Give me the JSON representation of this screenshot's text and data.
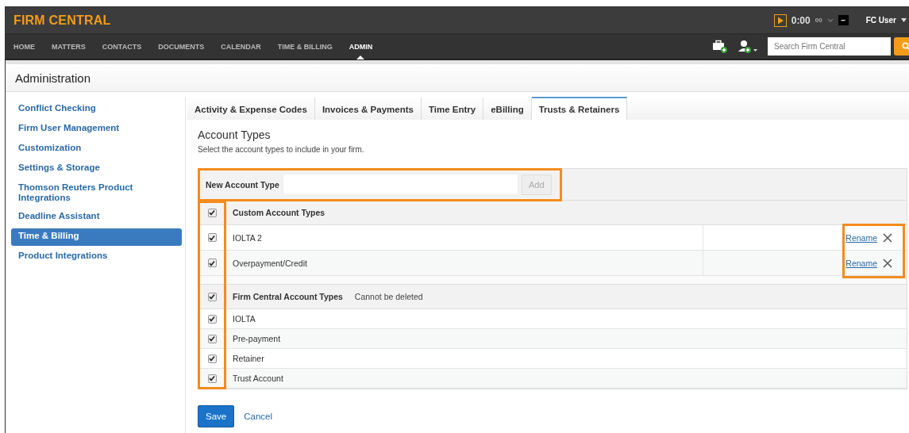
{
  "brand": "FIRM CENTRAL",
  "timer": {
    "time": "0:00",
    "seconds": "00",
    "stop": "–"
  },
  "user": "FC User",
  "nav": [
    {
      "label": "HOME",
      "selected": false
    },
    {
      "label": "MATTERS",
      "selected": false
    },
    {
      "label": "CONTACTS",
      "selected": false
    },
    {
      "label": "DOCUMENTS",
      "selected": false
    },
    {
      "label": "CALENDAR",
      "selected": false
    },
    {
      "label": "TIME & BILLING",
      "selected": false
    },
    {
      "label": "ADMIN",
      "selected": true
    }
  ],
  "search": {
    "placeholder": "Search Firm Central"
  },
  "page_title": "Administration",
  "sidebar": {
    "items": [
      {
        "label": "Conflict Checking",
        "selected": false
      },
      {
        "label": "Firm User Management",
        "selected": false
      },
      {
        "label": "Customization",
        "selected": false
      },
      {
        "label": "Settings & Storage",
        "selected": false
      },
      {
        "label": "Thomson Reuters Product Integrations",
        "selected": false
      },
      {
        "label": "Deadline Assistant",
        "selected": false
      },
      {
        "label": "Time & Billing",
        "selected": true
      },
      {
        "label": "Product Integrations",
        "selected": false
      }
    ]
  },
  "tabs": [
    {
      "label": "Activity & Expense Codes",
      "selected": false
    },
    {
      "label": "Invoices & Payments",
      "selected": false
    },
    {
      "label": "Time Entry",
      "selected": false
    },
    {
      "label": "eBilling",
      "selected": false
    },
    {
      "label": "Trusts & Retainers",
      "selected": true
    }
  ],
  "section": {
    "title": "Account Types",
    "subtitle": "Select the account types to include in your firm."
  },
  "new_account": {
    "label": "New Account Type",
    "button": "Add",
    "disabled": true
  },
  "groups": [
    {
      "title": "Custom Account Types",
      "checked": true,
      "rows": [
        {
          "name": "IOLTA 2",
          "checked": true,
          "action": "Rename"
        },
        {
          "name": "Overpayment/Credit",
          "checked": true,
          "action": "Rename"
        }
      ]
    },
    {
      "title": "Firm Central Account Types",
      "note": "Cannot be deleted",
      "checked": true,
      "rows": [
        {
          "name": "IOLTA",
          "checked": true
        },
        {
          "name": "Pre-payment",
          "checked": true
        },
        {
          "name": "Retainer",
          "checked": true
        },
        {
          "name": "Trust Account",
          "checked": true
        }
      ]
    }
  ],
  "buttons": {
    "save": "Save",
    "cancel": "Cancel"
  }
}
